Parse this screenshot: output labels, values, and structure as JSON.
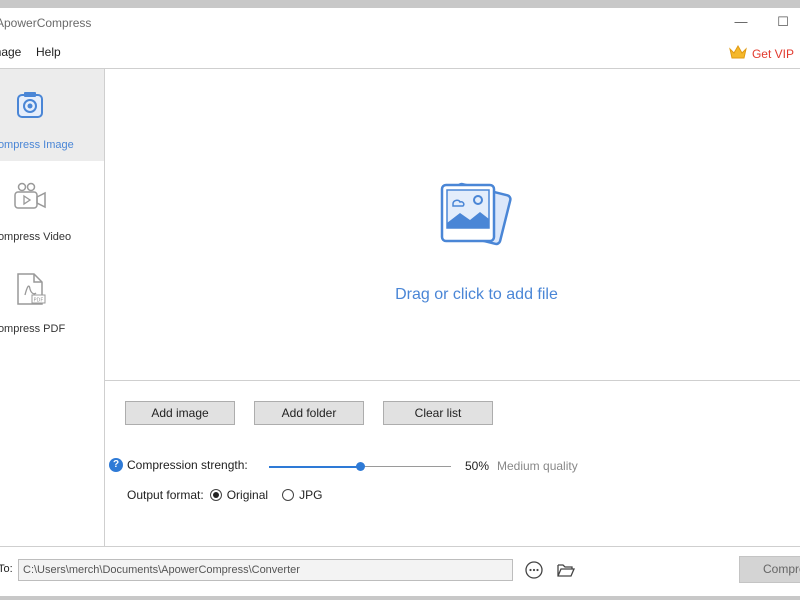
{
  "window": {
    "title": "ApowerCompress"
  },
  "menu": {
    "items": [
      "Image",
      "Help"
    ],
    "vip_label": "Get VIP"
  },
  "sidebar": {
    "items": [
      {
        "label": "Compress Image",
        "active": true
      },
      {
        "label": "Compress Video",
        "active": false
      },
      {
        "label": "Compress PDF",
        "active": false
      }
    ]
  },
  "dropzone": {
    "text": "Drag or click to add file"
  },
  "controls": {
    "add_image": "Add image",
    "add_folder": "Add folder",
    "clear_list": "Clear list",
    "strength_label": "Compression strength:",
    "strength_value": 0.5,
    "strength_percent": "50%",
    "quality_label": "Medium quality",
    "format_label": "Output format:",
    "format_options": [
      "Original",
      "JPG"
    ],
    "format_selected": "Original"
  },
  "footer": {
    "save_label": "To:",
    "path": "C:\\Users\\merch\\Documents\\ApowerCompress\\Converter",
    "compress_label": "Compress"
  },
  "colors": {
    "accent": "#4a86d6",
    "vip": "#e23a2e"
  }
}
